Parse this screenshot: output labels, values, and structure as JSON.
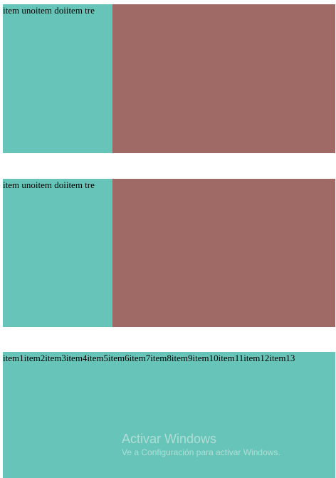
{
  "colors": {
    "teal": "#66c5b8",
    "rose": "#9f6966",
    "watermark": "#d8efea"
  },
  "row1": {
    "items": [
      "item uno",
      "item doi",
      "item tre"
    ]
  },
  "row2": {
    "items": [
      "item uno",
      "item doi",
      "item tre"
    ]
  },
  "row3": {
    "items": [
      "item1",
      "item2",
      "item3",
      "item4",
      "item5",
      "item6",
      "item7",
      "item8",
      "item9",
      "item10",
      "item11",
      "item12",
      "item13"
    ]
  },
  "watermark": {
    "title": "Activar Windows",
    "subtitle": "Ve a Configuración para activar Windows."
  }
}
